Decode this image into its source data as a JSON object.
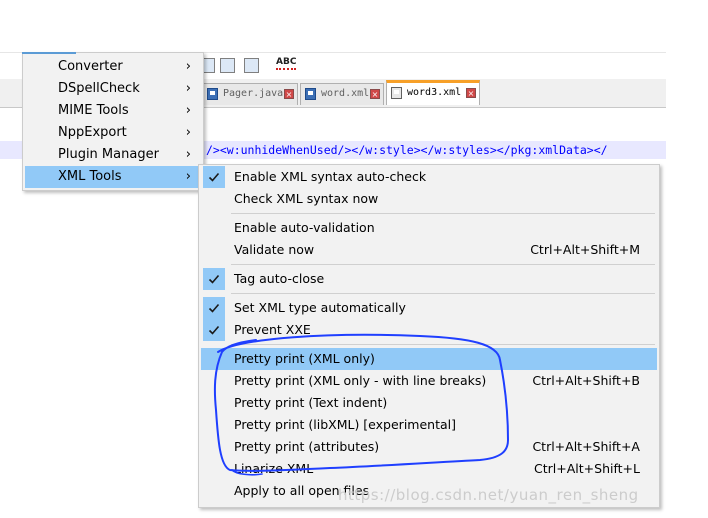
{
  "toolbar": {
    "spellcheck_label": "ABC"
  },
  "tabs": [
    {
      "label": "Pager.java",
      "active": false
    },
    {
      "label": "word.xml",
      "active": false
    },
    {
      "label": "word3.xml",
      "active": true
    }
  ],
  "editor": {
    "line_text": "/><w:unhideWhenUsed/></w:style></w:styles></pkg:xmlData></"
  },
  "plugins_menu": {
    "items": [
      {
        "label": "Converter",
        "arrow": "›"
      },
      {
        "label": "DSpellCheck",
        "arrow": "›"
      },
      {
        "label": "MIME Tools",
        "arrow": "›"
      },
      {
        "label": "NppExport",
        "arrow": "›"
      },
      {
        "label": "Plugin Manager",
        "arrow": "›"
      },
      {
        "label": "XML Tools",
        "arrow": "›",
        "highlighted": true
      }
    ]
  },
  "xml_menu": {
    "items": [
      {
        "label": "Enable XML syntax auto-check",
        "checked": true,
        "shortcut": ""
      },
      {
        "label": "Check XML syntax now",
        "checked": false,
        "shortcut": ""
      },
      {
        "label": "Enable auto-validation",
        "checked": false,
        "shortcut": ""
      },
      {
        "label": "Validate now",
        "checked": false,
        "shortcut": "Ctrl+Alt+Shift+M"
      },
      {
        "label": "Tag auto-close",
        "checked": true,
        "shortcut": ""
      },
      {
        "label": "Set XML type automatically",
        "checked": true,
        "shortcut": ""
      },
      {
        "label": "Prevent XXE",
        "checked": true,
        "shortcut": ""
      },
      {
        "label": "Pretty print (XML only)",
        "checked": false,
        "shortcut": "",
        "highlighted": true
      },
      {
        "label": "Pretty print (XML only - with line breaks)",
        "checked": false,
        "shortcut": "Ctrl+Alt+Shift+B"
      },
      {
        "label": "Pretty print (Text indent)",
        "checked": false,
        "shortcut": ""
      },
      {
        "label": "Pretty print (libXML) [experimental]",
        "checked": false,
        "shortcut": ""
      },
      {
        "label": "Pretty print (attributes)",
        "checked": false,
        "shortcut": "Ctrl+Alt+Shift+A"
      },
      {
        "label": "Linarize XML",
        "checked": false,
        "shortcut": "Ctrl+Alt+Shift+L"
      },
      {
        "label": "Apply to all open files",
        "checked": false,
        "shortcut": ""
      }
    ]
  },
  "watermark": "https://blog.csdn.net/yuan_ren_sheng",
  "colors": {
    "menu_bg": "#f2f2f2",
    "highlight": "#91c9f7",
    "annotation": "#1f3fff",
    "active_tab_accent": "#f7a028"
  }
}
